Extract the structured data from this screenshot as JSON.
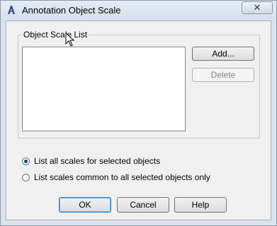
{
  "window": {
    "title": "Annotation Object Scale",
    "close_glyph": "✕",
    "app_icon": "autocad-a-icon"
  },
  "group": {
    "label": "Object Scale List",
    "list_items": []
  },
  "buttons": {
    "add": "Add...",
    "delete": "Delete",
    "ok": "OK",
    "cancel": "Cancel",
    "help": "Help"
  },
  "radios": [
    {
      "label": "List all scales for selected objects",
      "checked": true
    },
    {
      "label": "List scales common to all selected objects only",
      "checked": false
    }
  ],
  "colors": {
    "accent": "#3c7fb1",
    "app_icon": "#2b4f8c"
  }
}
